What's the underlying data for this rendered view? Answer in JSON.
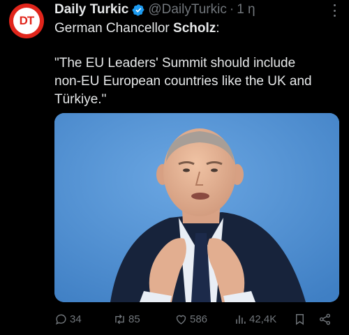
{
  "account": {
    "avatar_text": "DT",
    "display_name": "Daily Turkic",
    "handle": "@DailyTurkic",
    "separator": "·",
    "time": "1 η"
  },
  "tweet": {
    "line1_prefix": "German Chancellor ",
    "line1_bold": "Scholz",
    "line1_suffix": ":",
    "quote_lines": [
      "\"The EU Leaders' Summit should include",
      "non-EU European countries like the UK and",
      "Türkiye.\""
    ]
  },
  "actions": {
    "replies": "34",
    "reposts": "85",
    "likes": "586",
    "views": "42,4K"
  },
  "icons": {
    "verified": "verified-badge-icon",
    "more": "more-options-icon",
    "reply": "reply-icon",
    "repost": "repost-icon",
    "like": "heart-icon",
    "views": "views-icon",
    "bookmark": "bookmark-icon",
    "share": "share-icon"
  },
  "colors": {
    "background": "#000000",
    "text": "#e7e9ea",
    "muted": "#71767b",
    "verified": "#1d9bf0",
    "avatar_red": "#e1251b",
    "photo_backdrop": "#4e8ed0"
  }
}
